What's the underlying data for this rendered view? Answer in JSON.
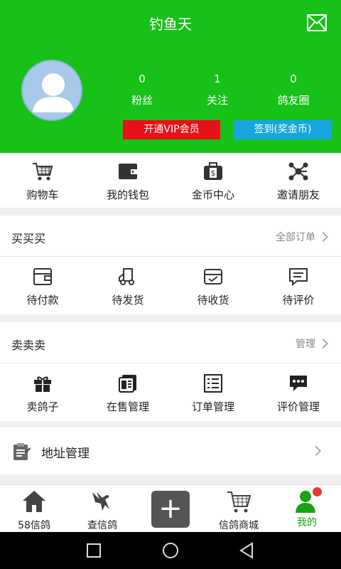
{
  "header": {
    "title": "钓鱼天",
    "stats": [
      {
        "count": "0",
        "label": "粉丝"
      },
      {
        "count": "1",
        "label": "关注"
      },
      {
        "count": "0",
        "label": "鸽友圈"
      }
    ],
    "vip_button": "开通VIP会员",
    "sign_button": "签到(奖金币)"
  },
  "quick": [
    {
      "label": "购物车",
      "icon": "shopping-cart-icon"
    },
    {
      "label": "我的钱包",
      "icon": "wallet-icon"
    },
    {
      "label": "金币中心",
      "icon": "coin-center-icon"
    },
    {
      "label": "邀请朋友",
      "icon": "invite-friends-icon"
    }
  ],
  "buy_section": {
    "title": "买买买",
    "link": "全部订单",
    "items": [
      {
        "label": "待付款",
        "icon": "pending-payment-icon"
      },
      {
        "label": "待发货",
        "icon": "pending-shipment-icon"
      },
      {
        "label": "待收货",
        "icon": "pending-receipt-icon"
      },
      {
        "label": "待评价",
        "icon": "pending-review-icon"
      }
    ]
  },
  "sell_section": {
    "title": "卖卖卖",
    "link": "管理",
    "items": [
      {
        "label": "卖鸽子",
        "icon": "gift-icon"
      },
      {
        "label": "在售管理",
        "icon": "on-sale-icon"
      },
      {
        "label": "订单管理",
        "icon": "order-list-icon"
      },
      {
        "label": "评价管理",
        "icon": "comment-icon"
      }
    ]
  },
  "address": {
    "label": "地址管理",
    "icon": "clipboard-icon"
  },
  "bottom_nav": [
    {
      "label": "58信鸽",
      "icon": "home-icon"
    },
    {
      "label": "查信鸽",
      "icon": "bird-icon"
    },
    {
      "label": "",
      "icon": "plus-icon"
    },
    {
      "label": "信鸽商城",
      "icon": "cart-icon"
    },
    {
      "label": "我的",
      "icon": "user-icon"
    }
  ],
  "colors": {
    "header_green": "#17c117",
    "vip_red": "#e8111a",
    "sign_blue": "#17a6df",
    "active_green": "#17a517"
  }
}
